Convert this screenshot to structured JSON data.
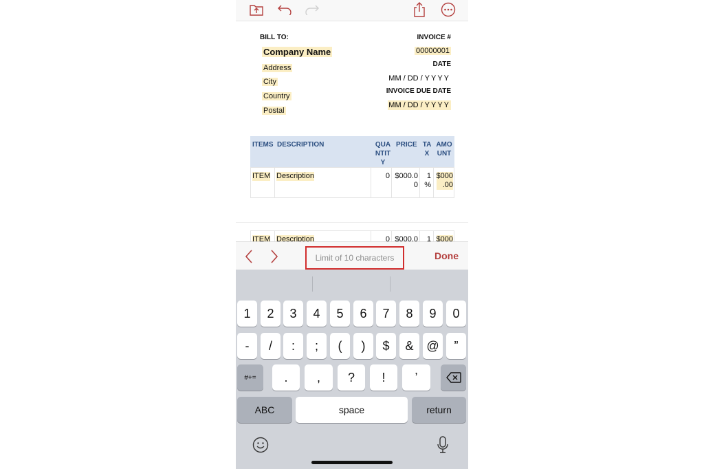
{
  "toolbar": {
    "icons": [
      "upload-doc-icon",
      "undo-icon",
      "redo-icon",
      "share-icon",
      "more-icon"
    ]
  },
  "invoice": {
    "bill_to_label": "BILL TO:",
    "company_name": "Company Name",
    "address": "Address",
    "city": "City",
    "country": "Country",
    "postal": "Postal",
    "invoice_number_label": "INVOICE #",
    "invoice_number": "00000001",
    "date_label": "DATE",
    "date_placeholder": [
      "MM",
      "DD",
      "YYYY"
    ],
    "due_date_label": "INVOICE DUE DATE",
    "due_date_placeholder": [
      "MM",
      "DD",
      "YYYY"
    ]
  },
  "table": {
    "headers": {
      "items": "ITEMS",
      "description": "DESCRIPTION",
      "quantity": "QUA\nNTIT\nY",
      "price": "PRICE",
      "tax": "TA\nX",
      "amount": "AMO\nUNT"
    },
    "rows": [
      {
        "item": "ITEM",
        "description": "Description",
        "quantity": "0",
        "price": "$000.0\n0",
        "tax": "1\n%",
        "amount": "$000\n.00"
      },
      {
        "item": "ITEM",
        "description": "Description",
        "quantity": "0",
        "price": "$000.0",
        "tax": "1",
        "amount": "$000"
      }
    ]
  },
  "accessory": {
    "hint": "Limit of 10 characters",
    "done": "Done"
  },
  "keyboard": {
    "row1": [
      "1",
      "2",
      "3",
      "4",
      "5",
      "6",
      "7",
      "8",
      "9",
      "0"
    ],
    "row2": [
      "-",
      "/",
      ":",
      ";",
      "(",
      ")",
      "$",
      "&",
      "@",
      "”"
    ],
    "row3_mode": "#+=",
    "row3": [
      ".",
      ",",
      "?",
      "!",
      "’"
    ],
    "abc": "ABC",
    "space": "space",
    "return": "return"
  },
  "colors": {
    "field_highlight": "#fbeec4",
    "header_bg": "#d9e3f1",
    "header_text": "#2b4e80",
    "done": "#b4403f",
    "callout": "#d12d2d",
    "keyboard_bg": "#d0d3d9"
  }
}
